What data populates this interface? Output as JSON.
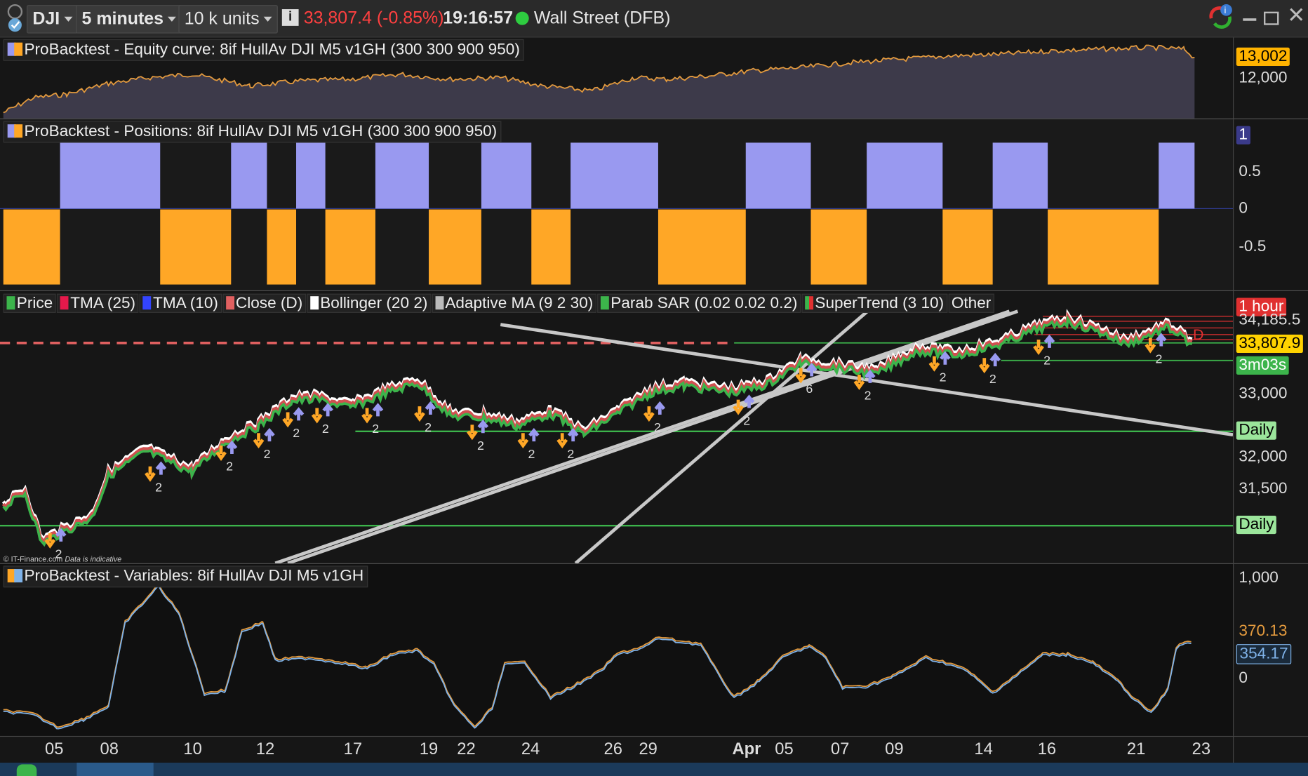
{
  "toolbar": {
    "symbol": "DJI",
    "timeframe": "5 minutes",
    "units": "10 k units",
    "info_icon": "info-icon",
    "price": "33,807.4 (-0.85%)",
    "time": "19:16:57",
    "market_status": "Wall Street (DFB)",
    "colors": {
      "price": "#ff4040",
      "status_dot": "#2ecc40"
    }
  },
  "equity_panel": {
    "title": "ProBacktest - Equity curve: 8if HullAv DJI M5 v1GH (300 300 900 950)",
    "last_value": "13,002",
    "axis_label": "12,000"
  },
  "positions_panel": {
    "title": "ProBacktest - Positions: 8if HullAv DJI M5 v1GH (300 300 900 950)",
    "axis_labels": [
      "1",
      "0.5",
      "0",
      "-0.5"
    ],
    "colors": {
      "long": "#9999f0",
      "short": "#ffa726"
    },
    "long_segments": [
      [
        72,
        192
      ],
      [
        277,
        320
      ],
      [
        355,
        390
      ],
      [
        450,
        514
      ],
      [
        577,
        637
      ],
      [
        684,
        789
      ],
      [
        894,
        972
      ],
      [
        1039,
        1130
      ],
      [
        1190,
        1256
      ],
      [
        1389,
        1432
      ]
    ],
    "short_segments": [
      [
        4,
        72
      ],
      [
        192,
        277
      ],
      [
        320,
        355
      ],
      [
        390,
        450
      ],
      [
        514,
        577
      ],
      [
        637,
        684
      ],
      [
        789,
        894
      ],
      [
        972,
        1039
      ],
      [
        1130,
        1190
      ],
      [
        1256,
        1389
      ]
    ]
  },
  "price_panel": {
    "legend": [
      "Price",
      "TMA (25)",
      "TMA (10)",
      "Close (D)",
      "Bollinger (20 2)",
      "Adaptive MA (9 2 30)",
      "Parab SAR (0.02 0.02 0.2)",
      "SuperTrend (3 10)",
      "Other"
    ],
    "legend_colors": [
      "#3cb44b",
      "#e6194b",
      "#3344ff",
      "#e06060",
      "#ffffff",
      "#bbbbbb",
      "#3cb44b",
      "#3cb44b",
      "#222222"
    ],
    "axis_labels": [
      "34,185.5",
      "33,000",
      "32,000",
      "31,500"
    ],
    "tags": {
      "hour": "1 hour",
      "last": "33,807.9",
      "countdown": "3m03s",
      "daily1": "Daily",
      "daily2": "Daily"
    },
    "trade_counts": [
      "2",
      "2",
      "2",
      "2",
      "2",
      "2",
      "2",
      "2",
      "2",
      "2",
      "2",
      "2",
      "2",
      "6",
      "2",
      "2",
      "2",
      "2",
      "2"
    ],
    "watermark": "© IT-Finance.com",
    "watermark_note": "Data is indicative"
  },
  "variables_panel": {
    "title": "ProBacktest - Variables: 8if HullAv DJI M5 v1GH",
    "axis_labels": [
      "1,000",
      "0"
    ],
    "tags": {
      "value1": "370.13",
      "value2": "354.17"
    }
  },
  "x_axis": {
    "labels": [
      "05",
      "08",
      "10",
      "12",
      "17",
      "19",
      "22",
      "24",
      "26",
      "29",
      "Apr",
      "05",
      "07",
      "09",
      "14",
      "16",
      "21",
      "23"
    ]
  }
}
